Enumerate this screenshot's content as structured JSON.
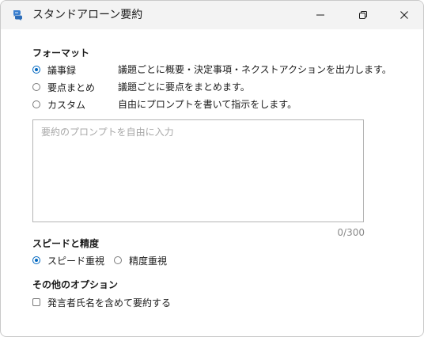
{
  "window": {
    "title": "スタンドアローン要約",
    "icon": "chat-bubbles-icon"
  },
  "format": {
    "heading": "フォーマット",
    "options": [
      {
        "label": "議事録",
        "description": "議題ごとに概要・決定事項・ネクストアクションを出力します。",
        "selected": true
      },
      {
        "label": "要点まとめ",
        "description": "議題ごとに要点をまとめます。",
        "selected": false
      },
      {
        "label": "カスタム",
        "description": "自由にプロンプトを書いて指示をします。",
        "selected": false
      }
    ]
  },
  "prompt": {
    "placeholder": "要約のプロンプトを自由に入力",
    "value": "",
    "counter": "0/300"
  },
  "speed": {
    "heading": "スピードと精度",
    "options": [
      {
        "label": "スピード重視",
        "selected": true
      },
      {
        "label": "精度重視",
        "selected": false
      }
    ]
  },
  "other": {
    "heading": "その他のオプション",
    "checkbox_label": "発言者氏名を含めて要約する",
    "checked": false
  },
  "colors": {
    "accent": "#0067c0",
    "titlebar": "#f3f3f3",
    "icon_blue": "#3a7fcf"
  }
}
